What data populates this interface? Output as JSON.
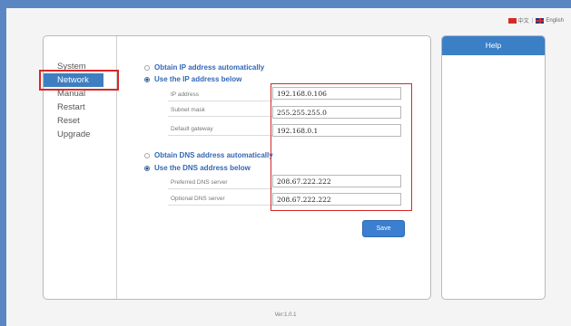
{
  "language": {
    "chinese": "中文",
    "english": "English"
  },
  "sidebar": {
    "items": [
      {
        "label": "System"
      },
      {
        "label": "Network"
      },
      {
        "label": "Manual"
      },
      {
        "label": "Restart"
      },
      {
        "label": "Reset"
      },
      {
        "label": "Upgrade"
      }
    ],
    "active": "Network"
  },
  "ip_settings": {
    "auto_label": "Obtain IP address automatically",
    "manual_label": "Use the IP address below",
    "selected": "manual",
    "fields": [
      {
        "label": "IP address",
        "value": "192.168.0.106"
      },
      {
        "label": "Subnet mask",
        "value": "255.255.255.0"
      },
      {
        "label": "Default gateway",
        "value": "192.168.0.1"
      }
    ]
  },
  "dns_settings": {
    "auto_label": "Obtain DNS address automatically",
    "manual_label": "Use the DNS address below",
    "selected": "manual",
    "fields": [
      {
        "label": "Preferred DNS server",
        "value": "208.67.222.222"
      },
      {
        "label": "Optional DNS server",
        "value": "208.67.222.222"
      }
    ]
  },
  "save_label": "Save",
  "help": {
    "title": "Help"
  },
  "footer": {
    "version": "Ver:1.0.1"
  },
  "colors": {
    "frame": "#5b86c4",
    "accent": "#3b7fc7",
    "highlight": "#d82727",
    "radio_label": "#3268b5"
  }
}
